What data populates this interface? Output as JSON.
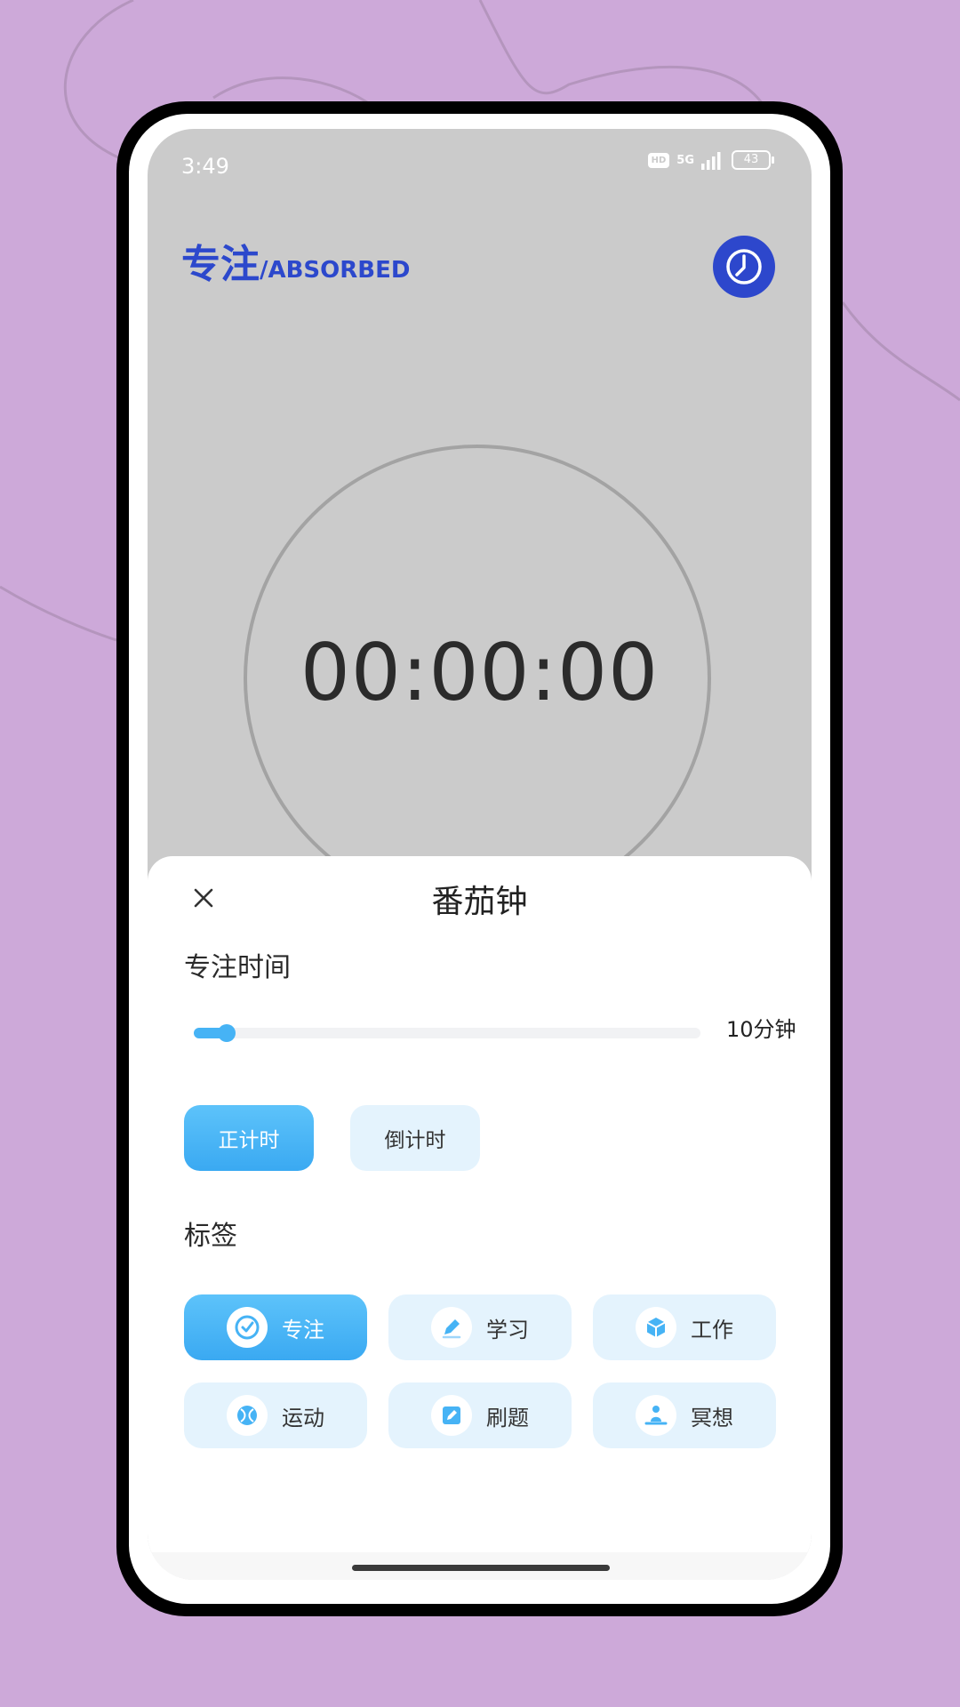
{
  "status_bar": {
    "time": "3:49",
    "hd": "HD",
    "network": "5G",
    "battery": "43"
  },
  "header": {
    "title_cn": "专注",
    "title_en": "/ABSORBED",
    "history_icon": "clock-icon"
  },
  "timer": {
    "display": "00:00:00"
  },
  "sheet": {
    "title": "番茄钟",
    "close_icon": "close-icon",
    "focus_time_label": "专注时间",
    "slider": {
      "value_label": "10分钟",
      "fill_fraction": 0.065
    },
    "modes": [
      {
        "label": "正计时",
        "active": true
      },
      {
        "label": "倒计时",
        "active": false
      }
    ],
    "tags_label": "标签",
    "tags": [
      {
        "label": "专注",
        "icon": "focus-check-icon",
        "active": true
      },
      {
        "label": "学习",
        "icon": "pencil-icon",
        "active": false
      },
      {
        "label": "工作",
        "icon": "cube-icon",
        "active": false
      },
      {
        "label": "运动",
        "icon": "ball-icon",
        "active": false
      },
      {
        "label": "刷题",
        "icon": "edit-note-icon",
        "active": false
      },
      {
        "label": "冥想",
        "icon": "meditation-icon",
        "active": false
      }
    ]
  },
  "colors": {
    "background": "#cda9d9",
    "brand_blue": "#2c48cc",
    "accent_blue": "#46b3f5",
    "light_blue": "#e4f3fd"
  }
}
